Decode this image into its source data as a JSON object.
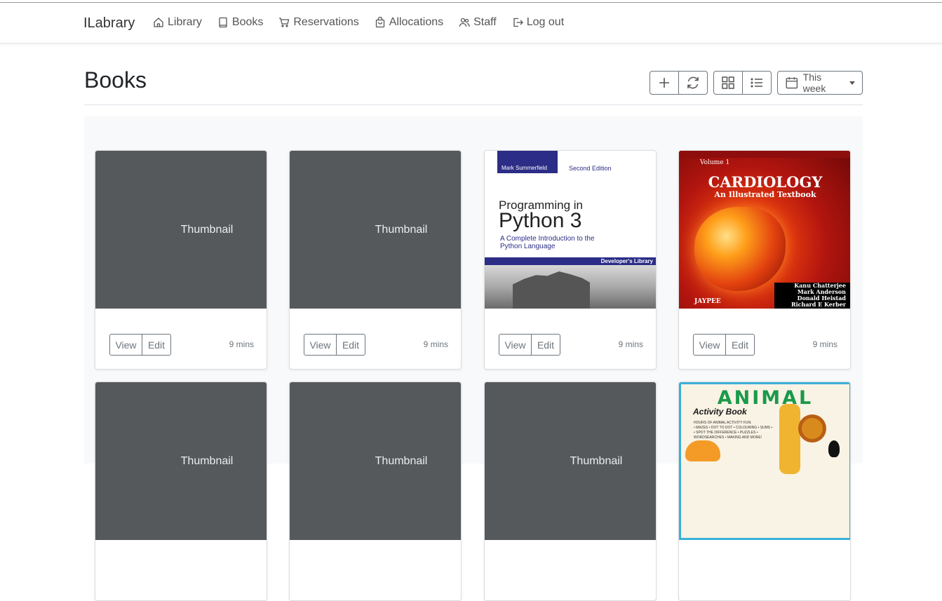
{
  "brand": "ILabrary",
  "nav": [
    {
      "label": "Library",
      "icon": "house-icon"
    },
    {
      "label": "Books",
      "icon": "book-icon"
    },
    {
      "label": "Reservations",
      "icon": "cart-icon"
    },
    {
      "label": "Allocations",
      "icon": "bag-icon"
    },
    {
      "label": "Staff",
      "icon": "people-icon"
    },
    {
      "label": "Log out",
      "icon": "logout-icon"
    }
  ],
  "page_title": "Books",
  "toolbar": {
    "add_icon": "plus-icon",
    "refresh_icon": "refresh-icon",
    "grid_icon": "grid-icon",
    "list_icon": "list-icon",
    "range_label": "This week"
  },
  "cards": [
    {
      "thumbnail": "Thumbnail",
      "view": "View",
      "edit": "Edit",
      "time": "9 mins"
    },
    {
      "thumbnail": "Thumbnail",
      "view": "View",
      "edit": "Edit",
      "time": "9 mins"
    },
    {
      "cover": {
        "author": "Mark Summerfield",
        "edition": "Second Edition",
        "title_line1": "Programming in",
        "title_line2": "Python 3",
        "subtitle_line1": "A Complete Introduction to the",
        "subtitle_line2": "Python Language",
        "series": "Developer's Library"
      },
      "view": "View",
      "edit": "Edit",
      "time": "9 mins"
    },
    {
      "cover": {
        "volume": "Volume 1",
        "title": "CARDIOLOGY",
        "subtitle": "An Illustrated Textbook",
        "authors": [
          "Kanu Chatterjee",
          "Mark Anderson",
          "Donald Heistad",
          "Richard E Kerber"
        ],
        "publisher": "JAYPEE"
      },
      "view": "View",
      "edit": "Edit",
      "time": "9 mins"
    },
    {
      "thumbnail": "Thumbnail"
    },
    {
      "thumbnail": "Thumbnail"
    },
    {
      "thumbnail": "Thumbnail"
    },
    {
      "cover": {
        "title": "ANIMAL",
        "subtitle": "Activity Book",
        "blurb_line1": "HOURS OF ANIMAL ACTIVITY FUN:",
        "blurb_line2": "• MAZES • DOT TO DOT • COLOURING • SUMS •",
        "blurb_line3": "• SPOT THE DIFFERENCE • PUZZLES •",
        "blurb_line4": "WORDSEARCHES • MAKING AND MORE!"
      }
    }
  ],
  "colors": {
    "thumbnail_bg": "#55595c",
    "album_bg": "#f8f9fa",
    "border": "#6c757d"
  }
}
